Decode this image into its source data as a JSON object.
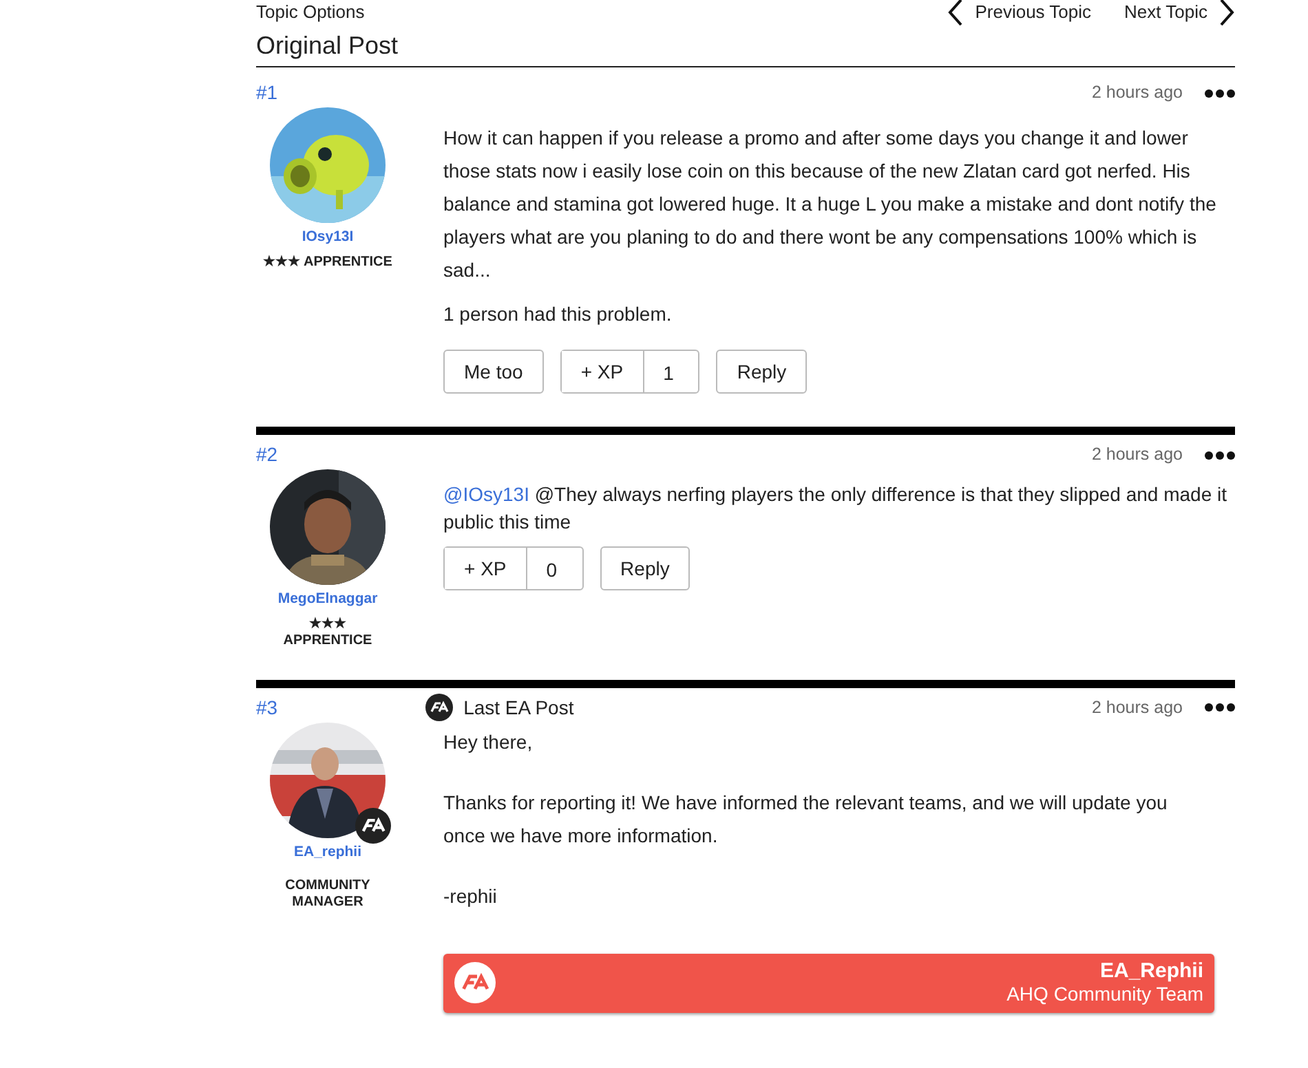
{
  "topic_bar": {
    "options": "Topic Options",
    "previous": "Previous Topic",
    "next": "Next Topic"
  },
  "section_title": "Original Post",
  "posts": [
    {
      "number": "#1",
      "time": "2 hours ago",
      "author": "IOsy13I",
      "ea_badge": false,
      "rank_lines": [
        "★★★ APPRENTICE"
      ],
      "paragraphs": [
        "How it can happen if you release a promo and after some days you change it and lower those stats now i easily lose coin on this because of the new Zlatan card got nerfed. His balance and stamina got lowered huge. It a huge L you make a mistake and dont notify the players what are you planing to do and there wont be any compensations 100% which is sad..."
      ],
      "problem_note": "1 person had this problem.",
      "me_too": "Me too",
      "xp": {
        "label": "+ XP",
        "count": "1"
      },
      "reply": "Reply"
    },
    {
      "number": "#2",
      "time": "2 hours ago",
      "author": "MegoElnaggar",
      "ea_badge": false,
      "rank_lines": [
        "★★★",
        "APPRENTICE"
      ],
      "mention": "@IOsy13I",
      "paragraphs": [
        "@They always nerfing players the only difference is that they slipped and made it public this time"
      ],
      "xp": {
        "label": "+ XP",
        "count": "0"
      },
      "reply": "Reply"
    },
    {
      "number": "#3",
      "ea_post_label": "Last EA Post",
      "time": "2 hours ago",
      "author": "EA_rephii",
      "ea_badge": true,
      "rank_lines": [
        "COMMUNITY MANAGER"
      ],
      "paragraphs": [
        "Hey there,",
        "Thanks for reporting it! We have informed the relevant teams, and we will update you once we have more information.",
        "-rephii"
      ],
      "signature": {
        "name": "EA_Rephii",
        "team": "AHQ Community Team"
      }
    }
  ]
}
